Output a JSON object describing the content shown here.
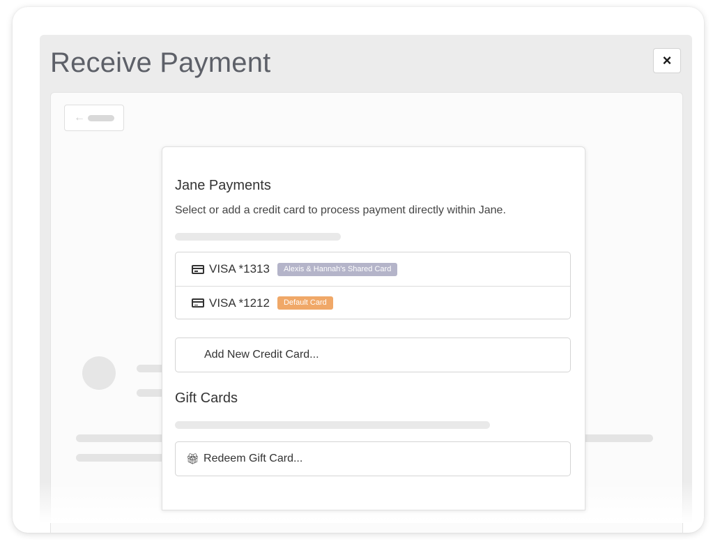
{
  "modal": {
    "title": "Receive Payment",
    "close_label": "×"
  },
  "back_button": {
    "arrow": "←"
  },
  "jane_payments": {
    "heading": "Jane Payments",
    "description": "Select or add a credit card to process payment directly within Jane.",
    "cards": [
      {
        "name": "VISA *1313",
        "badge": "Alexis & Hannah's Shared Card",
        "badge_color": "#b4b4c9",
        "icon": "credit-card-icon"
      },
      {
        "name": "VISA *1212",
        "badge": "Default Card",
        "badge_color": "#f0a868",
        "icon": "credit-card-icon"
      }
    ],
    "add_card_label": "Add New Credit Card..."
  },
  "gift_cards": {
    "heading": "Gift Cards",
    "redeem_label": "Redeem Gift Card...",
    "redeem_icon": "gift-icon"
  }
}
